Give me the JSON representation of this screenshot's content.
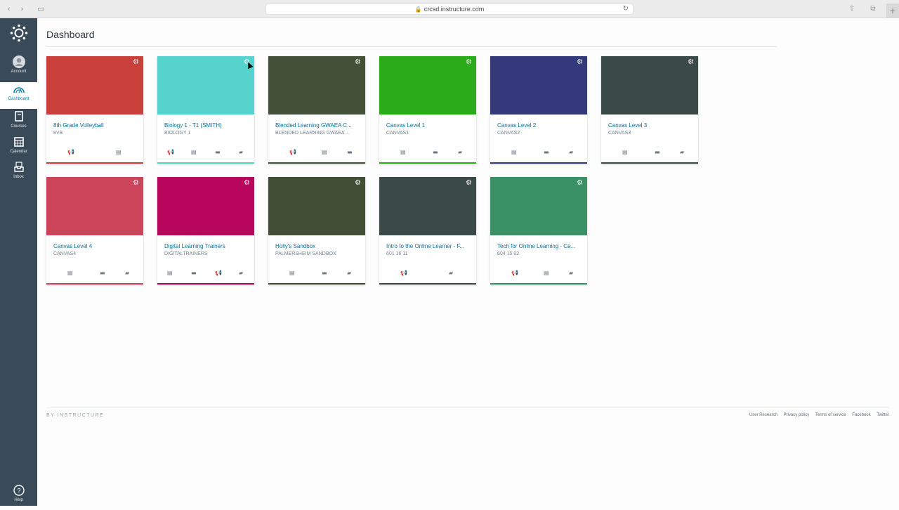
{
  "browser": {
    "url": "crcsd.instructure.com",
    "lock": "🔒"
  },
  "sidebar": {
    "items": [
      {
        "label": "Account",
        "icon": "account-icon"
      },
      {
        "label": "Dashboard",
        "icon": "dashboard-icon"
      },
      {
        "label": "Courses",
        "icon": "courses-icon"
      },
      {
        "label": "Calendar",
        "icon": "calendar-icon"
      },
      {
        "label": "Inbox",
        "icon": "inbox-icon"
      }
    ],
    "help_label": "Help"
  },
  "page": {
    "title": "Dashboard"
  },
  "cards": [
    {
      "title": "8th Grade Volleyball",
      "code": "8VB",
      "color": "#c9403a",
      "icons": [
        "announcement-icon",
        "assignment-icon"
      ]
    },
    {
      "title": "Biology 1 - T1 (SMITH)",
      "code": "BIOLOGY 1",
      "color": "#55d3cc",
      "icons": [
        "announcement-icon",
        "assignment-icon",
        "discussion-icon",
        "folder-icon"
      ]
    },
    {
      "title": "Blended Learning GWAEA C...",
      "code": "BLENDED LEARNING GWAEA ...",
      "color": "#425137",
      "icons": [
        "announcement-icon",
        "assignment-icon",
        "discussion-icon"
      ]
    },
    {
      "title": "Canvas Level 1",
      "code": "CANVAS1",
      "color": "#2bab19",
      "icons": [
        "assignment-icon",
        "discussion-icon",
        "folder-icon"
      ]
    },
    {
      "title": "Canvas Level 2",
      "code": "CANVAS2",
      "color": "#33397a",
      "icons": [
        "assignment-icon",
        "discussion-icon",
        "folder-icon"
      ]
    },
    {
      "title": "Canvas Level 3",
      "code": "CANVAS3",
      "color": "#3a4a47",
      "icons": [
        "assignment-icon",
        "discussion-icon",
        "folder-icon"
      ]
    },
    {
      "title": "Canvas Level 4",
      "code": "CANVAS4",
      "color": "#cc445a",
      "icons": [
        "assignment-icon",
        "discussion-icon",
        "folder-icon"
      ]
    },
    {
      "title": "Digital Learning Trainers",
      "code": "DIGITALTRAINERS",
      "color": "#b7065b",
      "icons": [
        "assignment-icon",
        "discussion-icon",
        "announcement-icon",
        "folder-icon"
      ]
    },
    {
      "title": "Holly's Sandbox",
      "code": "PALMERSHEIM SANDBOX",
      "color": "#424f37",
      "icons": [
        "assignment-icon",
        "discussion-icon",
        "folder-icon"
      ]
    },
    {
      "title": "Intro to the Online Learner - F...",
      "code": "601 16 11",
      "color": "#3a4b47",
      "icons": [
        "announcement-icon",
        "folder-icon"
      ]
    },
    {
      "title": "Tech for Online Learning - Ca...",
      "code": "604 15 02",
      "color": "#3a9165",
      "icons": [
        "announcement-icon",
        "assignment-icon",
        "folder-icon"
      ]
    }
  ],
  "footer": {
    "brand": "BY INSTRUCTURE",
    "links": [
      "User Research",
      "Privacy policy",
      "Terms of service",
      "Facebook",
      "Twitter"
    ]
  }
}
